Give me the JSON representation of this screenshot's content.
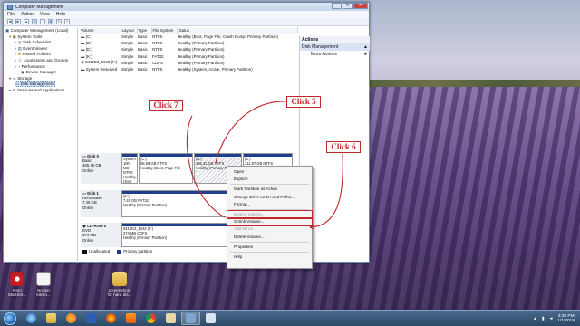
{
  "window": {
    "title": "Computer Management",
    "min": "–",
    "max": "□",
    "close": "✕"
  },
  "menu": [
    "File",
    "Action",
    "View",
    "Help"
  ],
  "tree": [
    {
      "label": "Computer Management (Local)",
      "indent": 0
    },
    {
      "label": "System Tools",
      "indent": 1
    },
    {
      "label": "Task Scheduler",
      "indent": 2
    },
    {
      "label": "Event Viewer",
      "indent": 2
    },
    {
      "label": "Shared Folders",
      "indent": 2
    },
    {
      "label": "Local Users and Groups",
      "indent": 2
    },
    {
      "label": "Performance",
      "indent": 2
    },
    {
      "label": "Device Manager",
      "indent": 2
    },
    {
      "label": "Storage",
      "indent": 1
    },
    {
      "label": "Disk Management",
      "indent": 2,
      "selected": true
    },
    {
      "label": "Services and Applications",
      "indent": 1
    }
  ],
  "volumes": {
    "columns": [
      "Volume",
      "Layout",
      "Type",
      "File System",
      "Status"
    ],
    "rows": [
      [
        "(C:)",
        "Simple",
        "Basic",
        "NTFS",
        "Healthy (Boot, Page File, Crash Dump, Primary Partition)"
      ],
      [
        "(D:)",
        "Simple",
        "Basic",
        "NTFS",
        "Healthy (Primary Partition)"
      ],
      [
        "(E:)",
        "Simple",
        "Basic",
        "NTFS",
        "Healthy (Primary Partition)"
      ],
      [
        "(K:)",
        "Simple",
        "Basic",
        "FAT32",
        "Healthy (Primary Partition)"
      ],
      [
        "0412E3_1043 (F:)",
        "Simple",
        "Basic",
        "CDFS",
        "Healthy (Primary Partition)"
      ],
      [
        "System Reserved",
        "Simple",
        "Basic",
        "NTFS",
        "Healthy (System, Active, Primary Partition)"
      ]
    ]
  },
  "actions": {
    "header": "Actions",
    "section": "Disk Management",
    "item": "More Actions"
  },
  "disks": {
    "disk0": {
      "name": "Disk 0",
      "type": "Basic",
      "size": "465.76 GB",
      "status": "Online",
      "parts": [
        {
          "name": "System",
          "detail": "100 MB NTFS",
          "status": "Healthy (Syst"
        },
        {
          "name": "(C:)",
          "detail": "58.59 GB NTFS",
          "status": "Healthy (Boot, Page File"
        },
        {
          "name": "(D:)",
          "detail": "195.31 GB NTFS",
          "status": "Healthy (Primary P"
        },
        {
          "name": "(E:)",
          "detail": "211.87 GB NTFS",
          "status": "Healthy (P"
        }
      ]
    },
    "disk1": {
      "name": "Disk 1",
      "type": "Removable",
      "size": "7.46 GB",
      "status": "Online",
      "part": {
        "name": "(K:)",
        "detail": "7.45 GB FAT32",
        "status": "Healthy (Primary Partition)"
      }
    },
    "cdrom": {
      "name": "CD-ROM 0",
      "type": "DVD",
      "size": "374 MB",
      "status": "Online",
      "part": {
        "name": "0412E3_1043 (F:)",
        "detail": "374 MB CDFS",
        "status": "Healthy (Primary Partition)"
      }
    }
  },
  "legend": {
    "unallocated": "Unallocated",
    "primary": "Primary partition",
    "unallocated_color": "#111111",
    "primary_color": "#1f3f8e"
  },
  "context_menu": [
    "Open",
    "Explore",
    "Mark Partition as Active",
    "Change Drive Letter and Paths...",
    "Format...",
    "Extend Volume...",
    "Shrink Volume...",
    "Add Mirror...",
    "Delete Volume...",
    "Properties",
    "Help"
  ],
  "callouts": {
    "c7": "Click 7",
    "c5": "Click 5",
    "c6": "Click 6",
    "color": "#c1272d"
  },
  "desktop": [
    {
      "label1": "Nero",
      "label2": "StartSm...",
      "color": "#d2232a"
    },
    {
      "label1": "Norton",
      "label2": "Intern...",
      "color": "#f0f0f0"
    },
    {
      "label1": "screenshots",
      "label2": "for hard dis...",
      "color": "#e8c260"
    }
  ],
  "taskbar": {
    "time": "3:20 PM",
    "date": "1/1/2018"
  }
}
